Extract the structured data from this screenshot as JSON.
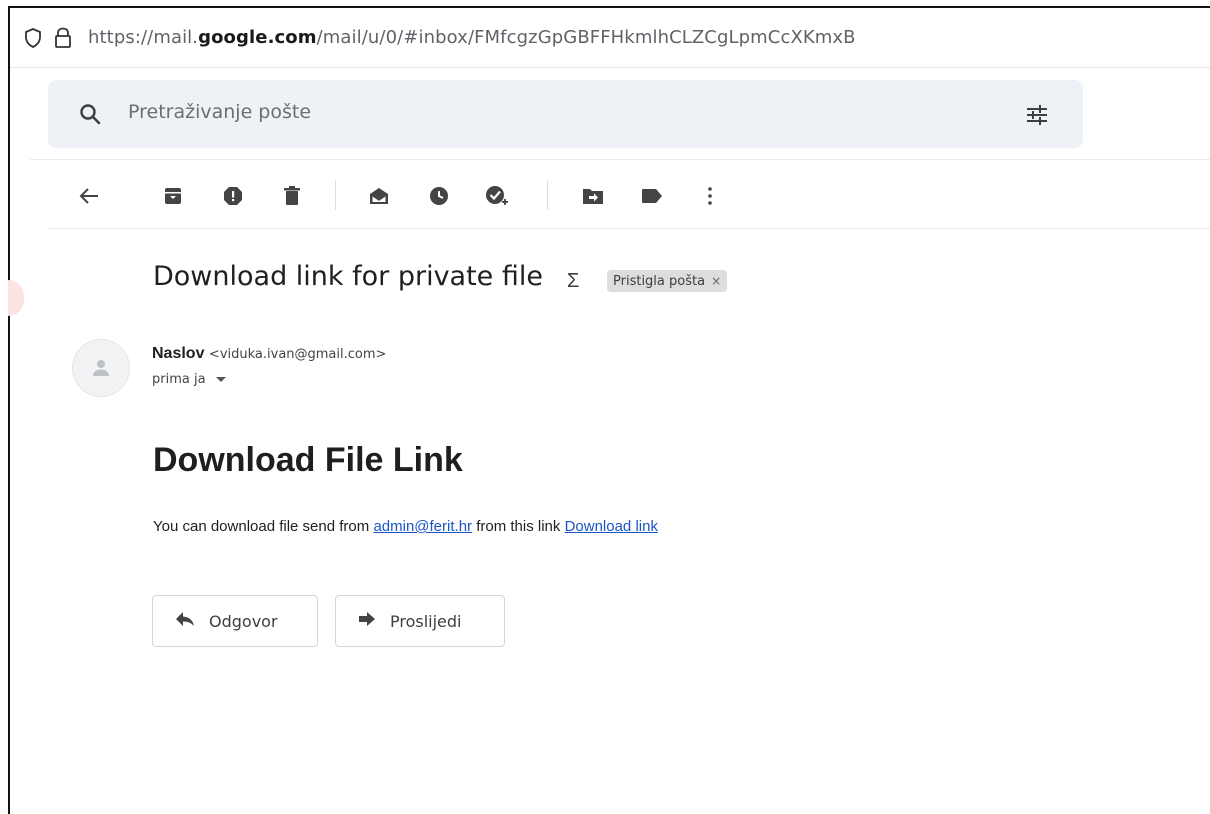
{
  "browser": {
    "url_prefix": "https://mail.",
    "url_domain": "google.com",
    "url_path": "/mail/u/0/#inbox/FMfcgzGpGBFFHkmlhCLZCgLpmCcXKmxB"
  },
  "search": {
    "placeholder": "Pretraživanje pošte"
  },
  "toolbar": {
    "icons": [
      "back-arrow-icon",
      "archive-icon",
      "report-spam-icon",
      "delete-icon",
      "mark-unread-icon",
      "snooze-icon",
      "add-to-tasks-icon",
      "move-to-icon",
      "labels-icon",
      "more-options-icon"
    ]
  },
  "message": {
    "subject": "Download link for private file",
    "importance_marker": "Σ",
    "label": "Pristigla pošta",
    "label_remove": "×",
    "sender_name": "Naslov",
    "sender_email": "<viduka.ivan@gmail.com>",
    "recipient": "prima ja",
    "body_title": "Download File Link",
    "body_text_before": "You can download file send from",
    "body_link_email": "admin@ferit.hr",
    "body_text_middle": "from this link",
    "body_link_download": "Download link"
  },
  "actions": {
    "reply_label": "Odgovor",
    "forward_label": "Proslijedi"
  },
  "colors": {
    "link": "#1a56c8",
    "search_bg": "#eef1f6",
    "chip_bg": "#dddddd"
  }
}
